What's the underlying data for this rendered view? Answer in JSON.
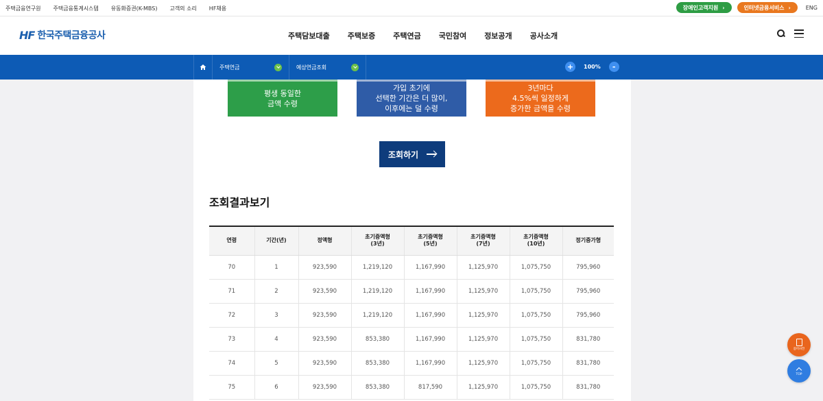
{
  "util_bar": {
    "links": [
      "주택금융연구원",
      "주택금융통계시스템",
      "유동화증권(K-MBS)",
      "고객의 소리",
      "HF채용"
    ],
    "disabled_support": "장애인고객지원",
    "internet_service": "인터넷금융서비스",
    "language": "ENG"
  },
  "header": {
    "logo_mark": "HF",
    "logo_text": "한국주택금융공사",
    "nav": [
      "주택담보대출",
      "주택보증",
      "주택연금",
      "국민참여",
      "정보공개",
      "공사소개"
    ]
  },
  "location": {
    "level1": "주택연금",
    "level2": "예상연금조회",
    "zoom": "100%",
    "zoom_in": "+",
    "zoom_out": "-"
  },
  "pension_types": [
    {
      "text": "평생 동일한\n금액 수령",
      "color": "#2d9e49"
    },
    {
      "text": "가입 초기에\n선택한 기간은 더 많이,\n이후에는 덜 수령",
      "color": "#2f5ca7"
    },
    {
      "text": "3년마다\n4.5%씩 일정하게\n증가한 금액을 수령",
      "color": "#ec6a1c"
    }
  ],
  "query_button": "조회하기",
  "section_title": "조회결과보기",
  "table": {
    "headers": [
      "연령",
      "기간(년)",
      "정액형",
      "초기증액형\n(3년)",
      "초기증액형\n(5년)",
      "초기증액형\n(7년)",
      "초기증액형\n(10년)",
      "정기증가형"
    ],
    "rows": [
      [
        "70",
        "1",
        "923,590",
        "1,219,120",
        "1,167,990",
        "1,125,970",
        "1,075,750",
        "795,960"
      ],
      [
        "71",
        "2",
        "923,590",
        "1,219,120",
        "1,167,990",
        "1,125,970",
        "1,075,750",
        "795,960"
      ],
      [
        "72",
        "3",
        "923,590",
        "1,219,120",
        "1,167,990",
        "1,125,970",
        "1,075,750",
        "795,960"
      ],
      [
        "73",
        "4",
        "923,590",
        "853,380",
        "1,167,990",
        "1,125,970",
        "1,075,750",
        "831,780"
      ],
      [
        "74",
        "5",
        "923,590",
        "853,380",
        "1,167,990",
        "1,125,970",
        "1,075,750",
        "831,780"
      ],
      [
        "75",
        "6",
        "923,590",
        "853,380",
        "817,590",
        "1,125,970",
        "1,075,750",
        "831,780"
      ]
    ]
  },
  "floating": {
    "consult_label": "용어사전",
    "top_label": "TOP"
  }
}
